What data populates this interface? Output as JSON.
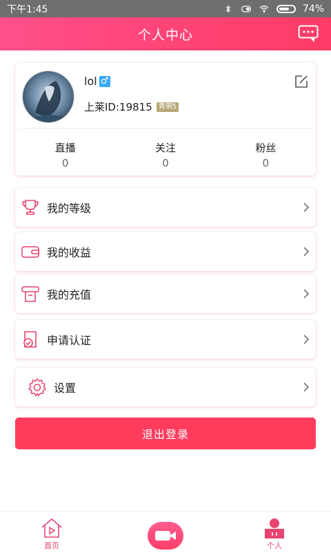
{
  "status_bar": {
    "time": "下午1:45",
    "battery": "74%"
  },
  "header": {
    "title": "个人中心",
    "icons": [
      "message-icon"
    ]
  },
  "profile": {
    "username": "lol",
    "gender_icon": "male-icon",
    "id_label": "上莱ID:19815",
    "level_badge": "青铜5",
    "stats": [
      {
        "label": "直播",
        "value": "0"
      },
      {
        "label": "关注",
        "value": "0"
      },
      {
        "label": "粉丝",
        "value": "0"
      }
    ]
  },
  "menu": [
    {
      "label": "我的等级",
      "icon": "trophy-icon"
    },
    {
      "label": "我的收益",
      "icon": "wallet-icon"
    },
    {
      "label": "我的充值",
      "icon": "recharge-icon"
    },
    {
      "label": "申请认证",
      "icon": "certificate-icon"
    },
    {
      "label": "设置",
      "icon": "gear-icon"
    }
  ],
  "logout_label": "退出登录",
  "tabbar": {
    "home_label": "首页",
    "me_label": "个人"
  },
  "colors": {
    "accent": "#ff3c5c",
    "header_gradient_start": "#ff4f8a",
    "header_gradient_end": "#ff3b66",
    "icon_pink": "#e8446f",
    "badge": "#b9a777"
  }
}
